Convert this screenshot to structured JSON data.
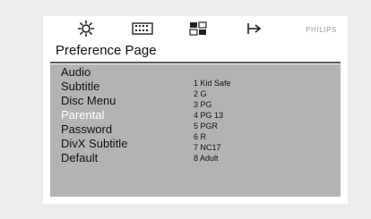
{
  "toolbar": {
    "icons": [
      "general-setup-icon",
      "audio-setup-icon",
      "video-setup-icon",
      "preference-setup-icon"
    ],
    "brand": "PHILIPS"
  },
  "page": {
    "title": "Preference Page"
  },
  "menu": {
    "items": [
      {
        "label": "Audio"
      },
      {
        "label": "Subtitle"
      },
      {
        "label": "Disc Menu"
      },
      {
        "label": "Parental",
        "selected": true
      },
      {
        "label": "Password"
      },
      {
        "label": "DivX Subtitle"
      },
      {
        "label": "Default"
      }
    ]
  },
  "parental_options": [
    "1 Kid Safe",
    "2 G",
    "3 PG",
    "4 PG 13",
    "5 PGR",
    "6 R",
    "7 NC17",
    "8 Adult"
  ],
  "colors": {
    "panel": "#b3b3b3",
    "selected_text": "#ffffff",
    "text": "#111111"
  }
}
